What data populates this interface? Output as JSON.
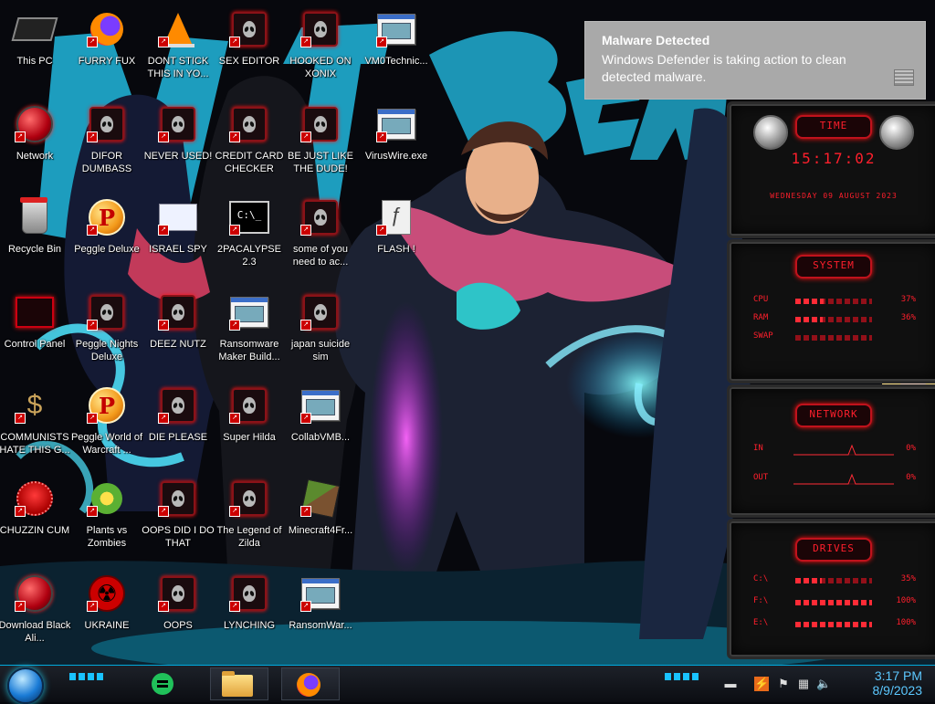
{
  "desktop": {
    "icons": [
      {
        "label": "This PC",
        "icon": "computer-icon"
      },
      {
        "label": "FURRY FUX",
        "icon": "firefox-icon"
      },
      {
        "label": "DONT STICK THIS IN YO...",
        "icon": "vlc-cone-icon"
      },
      {
        "label": "SEX EDITOR",
        "icon": "alien-app-icon"
      },
      {
        "label": "HOOKED ON XONIX",
        "icon": "alien-app-icon"
      },
      {
        "label": "VM0Technic...",
        "icon": "exe-window-icon"
      },
      {
        "label": "Network",
        "icon": "network-orb-icon"
      },
      {
        "label": "DIFOR DUMBASS",
        "icon": "alien-app-icon"
      },
      {
        "label": "NEVER USED!",
        "icon": "alien-app-icon"
      },
      {
        "label": "CREDIT CARD CHECKER",
        "icon": "alien-app-icon"
      },
      {
        "label": "BE JUST LIKE THE DUDE!",
        "icon": "alien-app-icon"
      },
      {
        "label": "VirusWire.exe",
        "icon": "exe-window-icon"
      },
      {
        "label": "Recycle Bin",
        "icon": "recycle-bin-icon"
      },
      {
        "label": "Peggle Deluxe",
        "icon": "peggle-icon"
      },
      {
        "label": "ISRAEL SPY",
        "icon": "window-app-icon"
      },
      {
        "label": "2PACALYPSE 2.3",
        "icon": "command-prompt-icon"
      },
      {
        "label": "some of you need to ac...",
        "icon": "alien-app-icon"
      },
      {
        "label": "FLASH !",
        "icon": "flash-document-icon"
      },
      {
        "label": "Control Panel",
        "icon": "control-panel-icon"
      },
      {
        "label": "Peggle Nights Deluxe",
        "icon": "alien-app-icon"
      },
      {
        "label": "DEEZ NUTZ",
        "icon": "alien-app-icon"
      },
      {
        "label": "Ransomware Maker Build...",
        "icon": "exe-window-icon"
      },
      {
        "label": "japan suicide sim",
        "icon": "alien-app-icon"
      },
      {
        "label": "COMMUNISTS HATE THIS G...",
        "icon": "money-bag-icon"
      },
      {
        "label": "Peggle World of Warcraft ...",
        "icon": "peggle-icon"
      },
      {
        "label": "DIE PLEASE",
        "icon": "alien-app-icon"
      },
      {
        "label": "Super Hilda",
        "icon": "alien-app-icon"
      },
      {
        "label": "CollabVMB...",
        "icon": "exe-window-icon"
      },
      {
        "label": "CHUZZIN CUM",
        "icon": "chuzzle-icon"
      },
      {
        "label": "Plants vs Zombies",
        "icon": "plants-icon"
      },
      {
        "label": "OOPS DID I DO THAT",
        "icon": "alien-app-icon"
      },
      {
        "label": "The Legend of Zilda",
        "icon": "alien-app-icon"
      },
      {
        "label": "Minecraft4Fr...",
        "icon": "minecraft-block-icon"
      },
      {
        "label": "Download Black Ali...",
        "icon": "network-orb-icon"
      },
      {
        "label": "UKRAINE",
        "icon": "radiation-icon"
      },
      {
        "label": "OOPS",
        "icon": "alien-app-icon"
      },
      {
        "label": "LYNCHING",
        "icon": "alien-app-icon"
      },
      {
        "label": "RansomWar...",
        "icon": "exe-window-icon"
      }
    ]
  },
  "notification": {
    "title": "Malware Detected",
    "body": "Windows Defender is taking action to clean detected malware."
  },
  "gadgets": {
    "time": {
      "title": "TIME",
      "clock": "15:17:02",
      "date": "WEDNESDAY 09 AUGUST 2023"
    },
    "system": {
      "title": "SYSTEM",
      "rows": [
        {
          "label": "CPU",
          "value": "37%",
          "level": 0.37
        },
        {
          "label": "RAM",
          "value": "36%",
          "level": 0.36
        },
        {
          "label": "SWAP",
          "value": "",
          "level": 0.0
        }
      ]
    },
    "network": {
      "title": "NETWORK",
      "rows": [
        {
          "label": "IN",
          "value": "0%"
        },
        {
          "label": "OUT",
          "value": "0%"
        }
      ]
    },
    "drives": {
      "title": "DRIVES",
      "rows": [
        {
          "label": "C:\\",
          "value": "35%",
          "level": 0.35
        },
        {
          "label": "F:\\",
          "value": "100%",
          "level": 1.0
        },
        {
          "label": "E:\\",
          "value": "100%",
          "level": 1.0
        }
      ]
    }
  },
  "taskbar": {
    "apps": [
      {
        "name": "green-app-icon"
      },
      {
        "name": "file-explorer-icon"
      },
      {
        "name": "firefox-icon"
      }
    ],
    "tray": {
      "time": "3:17 PM",
      "date": "8/9/2023"
    }
  },
  "colors": {
    "gadget_red": "#ff1f2c",
    "taskbar_accent": "#19c2ff",
    "clock_blue": "#5cc8ff"
  }
}
